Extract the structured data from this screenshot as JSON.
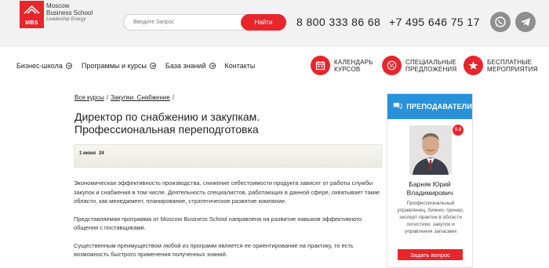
{
  "logo": {
    "abbr": "MBS",
    "line1": "Moscow",
    "line2": "Business School",
    "line3": "Leadership Energy"
  },
  "search": {
    "placeholder": "Введите Запрос",
    "button": "Найти"
  },
  "phones": [
    "8 800 333 86 68",
    "+7 495 646 75 17"
  ],
  "nav": {
    "items": [
      {
        "label": "Бизнес-школа",
        "dropdown": true
      },
      {
        "label": "Программы и курсы",
        "dropdown": true
      },
      {
        "label": "База знаний",
        "dropdown": true
      },
      {
        "label": "Контакты",
        "dropdown": false
      }
    ]
  },
  "quick_links": [
    {
      "line1": "КАЛЕНДАРЬ",
      "line2": "КУРСОВ",
      "icon": "calendar-icon"
    },
    {
      "line1": "СПЕЦИАЛЬНЫЕ",
      "line2": "ПРЕДЛОЖЕНИЯ",
      "icon": "percent-icon"
    },
    {
      "line1": "БЕСПЛАТНЫЕ",
      "line2": "МЕРОПРИЯТИЯ",
      "icon": "star-icon"
    }
  ],
  "breadcrumb": {
    "items": [
      "Все курсы",
      "Закупки. Снабжение"
    ],
    "separator": "/"
  },
  "page": {
    "title_line1": "Директор по снабжению и закупкам.",
    "title_line2": "Профессиональная переподготовка",
    "date": "1 июня",
    "date_extra": "24",
    "paragraphs": [
      "Экономическая эффективность производства, снижение себестоимости продукта зависят от работы службы закупок и снабжения в том числе. Деятельность специалистов, работающих в данной сфере, охватывает такие области, как менеджмент, планирование, стратегическое развитие компании.",
      "Представляемая программа от Moscow Business School направлена на развитие навыков эффективного общения с поставщиками.",
      "Существенным преимуществом любой из программ является ее ориентирование на практику, то есть возможность быстрого применения полученных знаний."
    ]
  },
  "teachers": {
    "header": "ПРЕПОДАВАТЕЛИ",
    "rating": "9.8",
    "name_line1": "Барняк Юрий",
    "name_line2": "Владимирович",
    "desc": "Профессиональный управленец, бизнес-тренер, эксперт-практик в области логистики, закупок и управления запасами",
    "button": "Задать вопрос"
  },
  "colors": {
    "accent": "#e8252b",
    "teachers_header": "#2792d9",
    "topbar": "#f2f2f2"
  }
}
